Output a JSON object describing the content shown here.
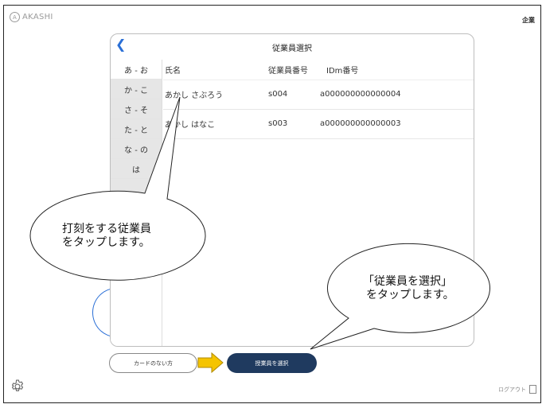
{
  "header": {
    "logo_text": "AKASHI",
    "company_label": "企業"
  },
  "panel": {
    "title": "従業員選択",
    "back_icon": "chevron-left-icon",
    "kana_tabs": [
      "あ - お",
      "か - こ",
      "さ - そ",
      "た - と",
      "な - の",
      "は",
      "",
      "",
      ""
    ],
    "columns": [
      "氏名",
      "従業員番号",
      "IDm番号"
    ],
    "rows": [
      {
        "name": "あかし さぶろう",
        "employee_no": "s004",
        "idm": "a000000000000004"
      },
      {
        "name": "あかし はなこ",
        "employee_no": "s003",
        "idm": "a000000000000003"
      }
    ]
  },
  "buttons": {
    "no_card": "カードのない方",
    "select": "授業員を選択"
  },
  "footer": {
    "settings_icon": "gear-icon",
    "logout_label": "ログアウト"
  },
  "annotations": {
    "callout1_line1": "打刻をする従業員",
    "callout1_line2": "をタップします。",
    "callout2_line1": "「従業員を選択」",
    "callout2_line2": "をタップします。"
  },
  "colors": {
    "accent": "#2a6fd6",
    "primary_button": "#1f3a5f",
    "arrow": "#f5c400"
  }
}
